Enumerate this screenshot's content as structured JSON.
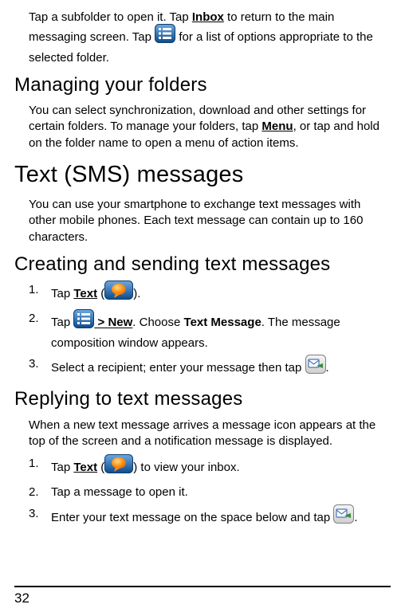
{
  "intro": {
    "p1a": "Tap a subfolder to open it. Tap ",
    "inbox": "Inbox",
    "p1b": " to return to the main messaging screen. Tap ",
    "p1c": " for a list of options appropriate to the selected folder."
  },
  "managing": {
    "heading": "Managing your folders",
    "p1a": "You can select synchronization, download and other settings for certain folders. To manage your folders, tap ",
    "menu": "Menu",
    "p1b": ", or tap and hold on the folder name to open a menu of action items."
  },
  "sms": {
    "heading": "Text (SMS) messages",
    "p1": "You can use your smartphone to exchange text messages with other mobile phones. Each text message can contain up to 160 characters."
  },
  "creating": {
    "heading": "Creating and sending text messages",
    "li1a": "Tap ",
    "text": "Text",
    "li1b": " (",
    "li1c": ").",
    "li2a": "Tap ",
    "gt_new": " > New",
    "li2b": ". Choose ",
    "text_message": "Text Message",
    "li2c": ". The message composition window appears.",
    "li3a": "Select a recipient; enter your message then tap ",
    "li3b": "."
  },
  "replying": {
    "heading": "Replying to text messages",
    "p1": "When a new text message arrives a message icon appears at the top of the screen and a notification message is displayed.",
    "li1a": "Tap ",
    "text": "Text",
    "li1b": " (",
    "li1c": ") to view your inbox.",
    "li2": "Tap a message to open it.",
    "li3a": "Enter your text message on the space below and tap ",
    "li3b": "."
  },
  "nums": {
    "n1": "1.",
    "n2": "2.",
    "n3": "3."
  },
  "page_number": "32"
}
